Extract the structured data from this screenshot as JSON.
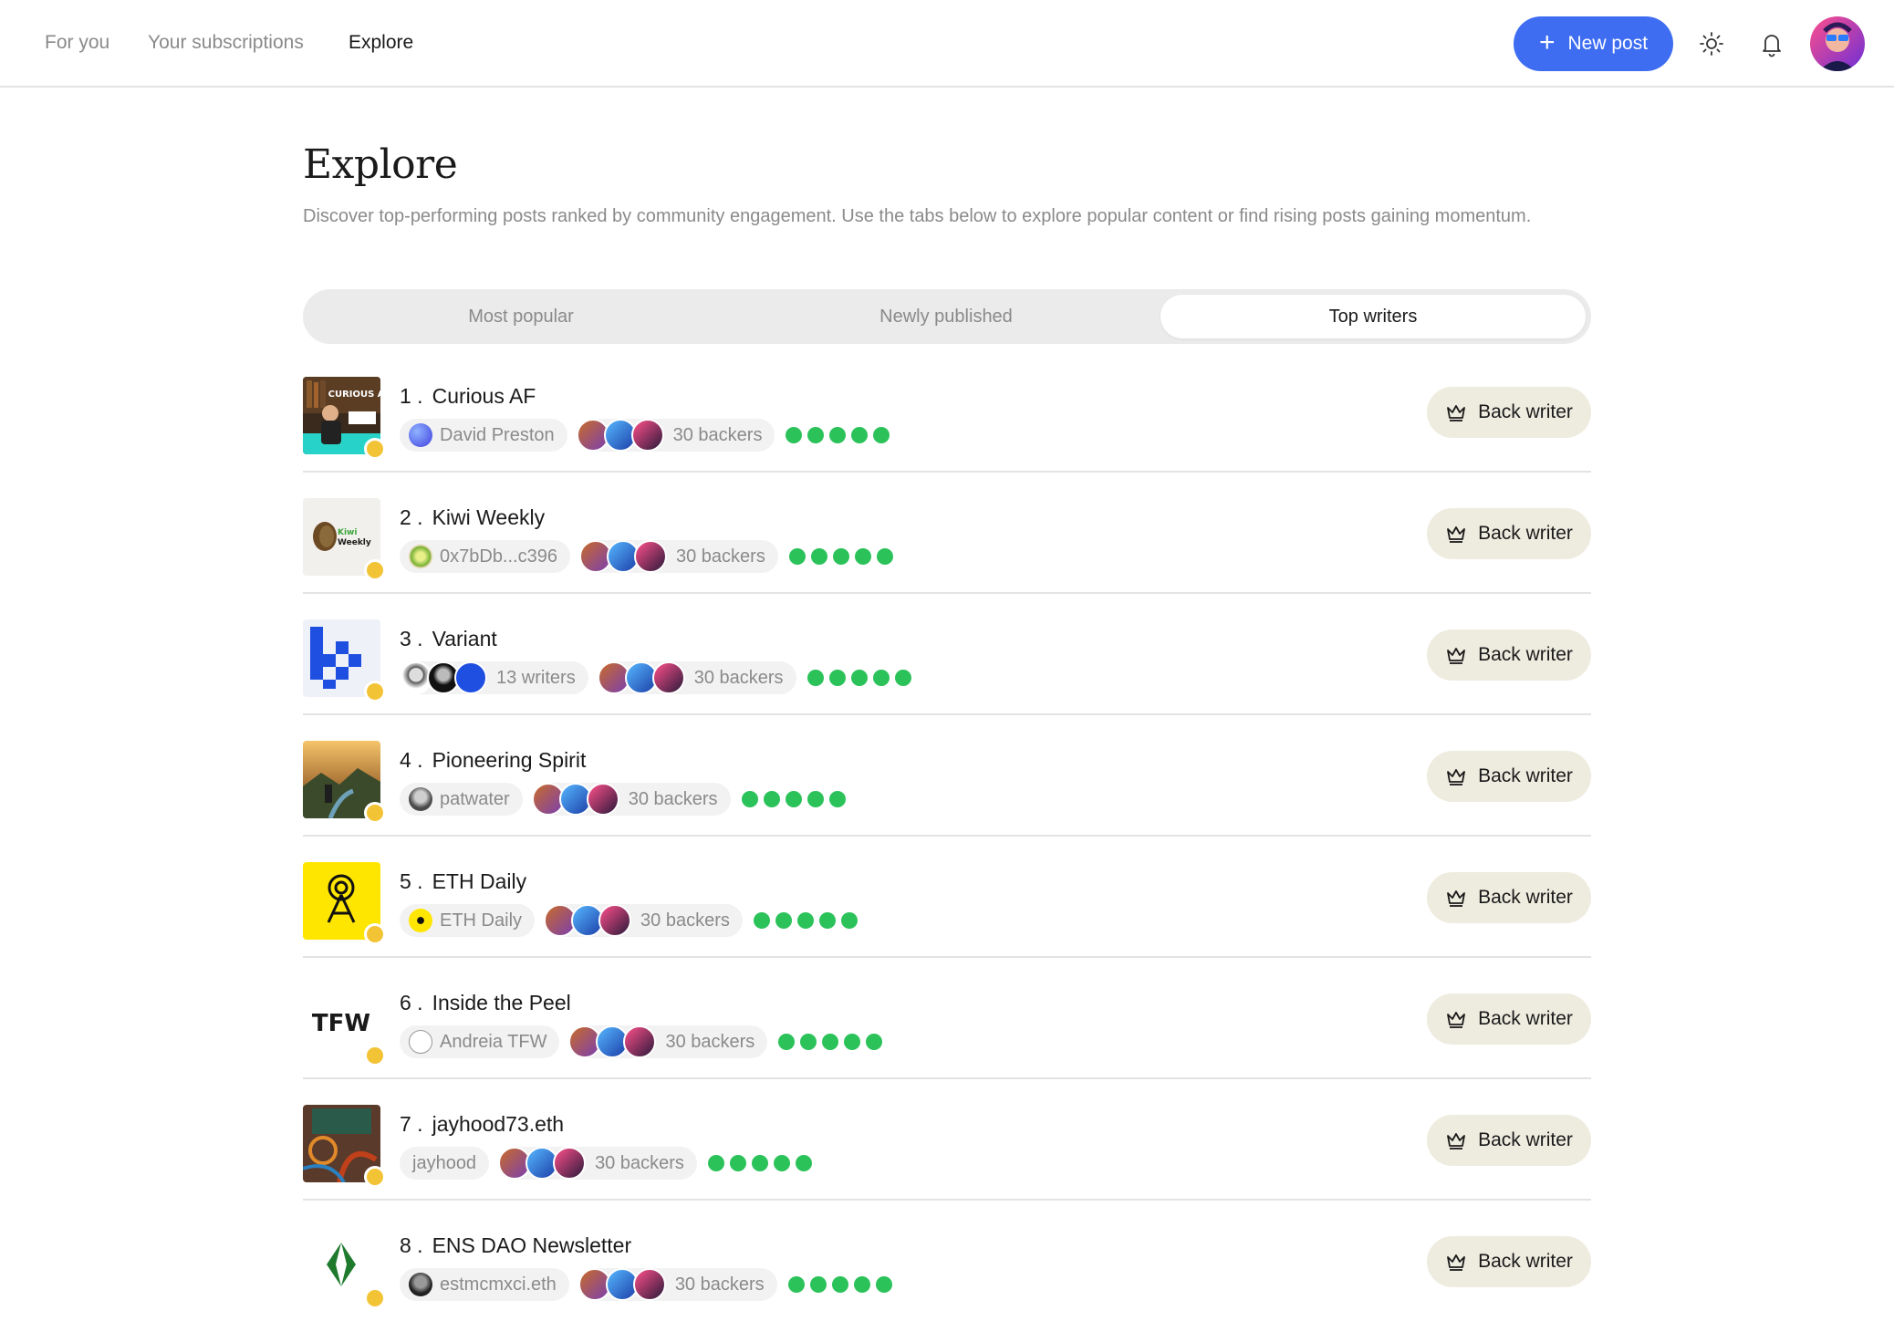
{
  "nav": {
    "tabs": [
      {
        "label": "For you"
      },
      {
        "label": "Your subscriptions"
      },
      {
        "label": "Explore"
      }
    ],
    "new_post_label": "New post"
  },
  "header": {
    "title": "Explore",
    "description": "Discover top-performing posts ranked by community engagement. Use the tabs below to explore popular content or find rising posts gaining momentum."
  },
  "tabs": [
    {
      "label": "Most popular"
    },
    {
      "label": "Newly published"
    },
    {
      "label": "Top writers",
      "active": true
    }
  ],
  "writers": [
    {
      "rank": "1 .",
      "name": "Curious AF",
      "author": "David Preston",
      "backers": "30 backers",
      "back_label": "Back writer"
    },
    {
      "rank": "2 .",
      "name": "Kiwi Weekly",
      "author": "0x7bDb...c396",
      "backers": "30 backers",
      "back_label": "Back writer"
    },
    {
      "rank": "3 .",
      "name": "Variant",
      "author": "13 writers",
      "backers": "30 backers",
      "back_label": "Back writer"
    },
    {
      "rank": "4 .",
      "name": "Pioneering Spirit",
      "author": "patwater",
      "backers": "30 backers",
      "back_label": "Back writer"
    },
    {
      "rank": "5 .",
      "name": "ETH Daily",
      "author": "ETH Daily",
      "backers": "30 backers",
      "back_label": "Back writer"
    },
    {
      "rank": "6 .",
      "name": "Inside the Peel",
      "author": "Andreia TFW",
      "backers": "30 backers",
      "back_label": "Back writer"
    },
    {
      "rank": "7 .",
      "name": "jayhood73.eth",
      "author": "jayhood",
      "backers": "30 backers",
      "back_label": "Back writer"
    },
    {
      "rank": "8 .",
      "name": "ENS DAO Newsletter",
      "author": "estmcmxci.eth",
      "backers": "30 backers",
      "back_label": "Back writer"
    }
  ],
  "thumb_text": {
    "curious": "CURIOUS AF",
    "kiwi_1": "Kiwi",
    "kiwi_2": "Weekly",
    "tfw": "TFW"
  },
  "colors": {
    "accent": "#3e6df2",
    "score_dot": "#2bc25a",
    "verified_badge": "#f3c336",
    "back_button_bg": "#eeebdf"
  },
  "icons": {
    "new_post": "plus-icon",
    "theme": "sun-icon",
    "notifications": "bell-icon",
    "back_writer": "crown-icon"
  }
}
